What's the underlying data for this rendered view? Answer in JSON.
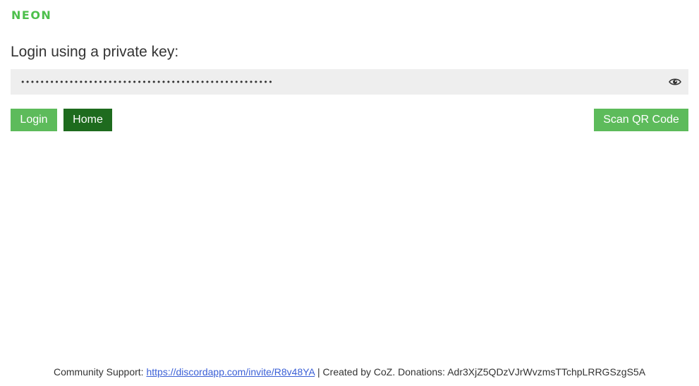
{
  "header": {
    "logo_text": "NEON"
  },
  "login": {
    "heading": "Login using a private key:",
    "key_value": "••••••••••••••••••••••••••••••••••••••••••••••••••••",
    "reveal_icon": "eye-icon",
    "login_label": "Login",
    "home_label": "Home",
    "scan_qr_label": "Scan QR Code"
  },
  "footer": {
    "support_prefix": "Community Support:",
    "support_link": "https://discordapp.com/invite/R8v48YA",
    "credits": "| Created by CoZ. Donations: Adr3XjZ5QDzVJrWvzmsTTchpLRRGSzgS5A"
  },
  "colors": {
    "brand_green": "#4cbf4b",
    "button_green": "#5dbb5b",
    "button_dark_green": "#1e6b1e",
    "link_blue": "#3a5fd6",
    "field_bg": "#eeeeee"
  }
}
